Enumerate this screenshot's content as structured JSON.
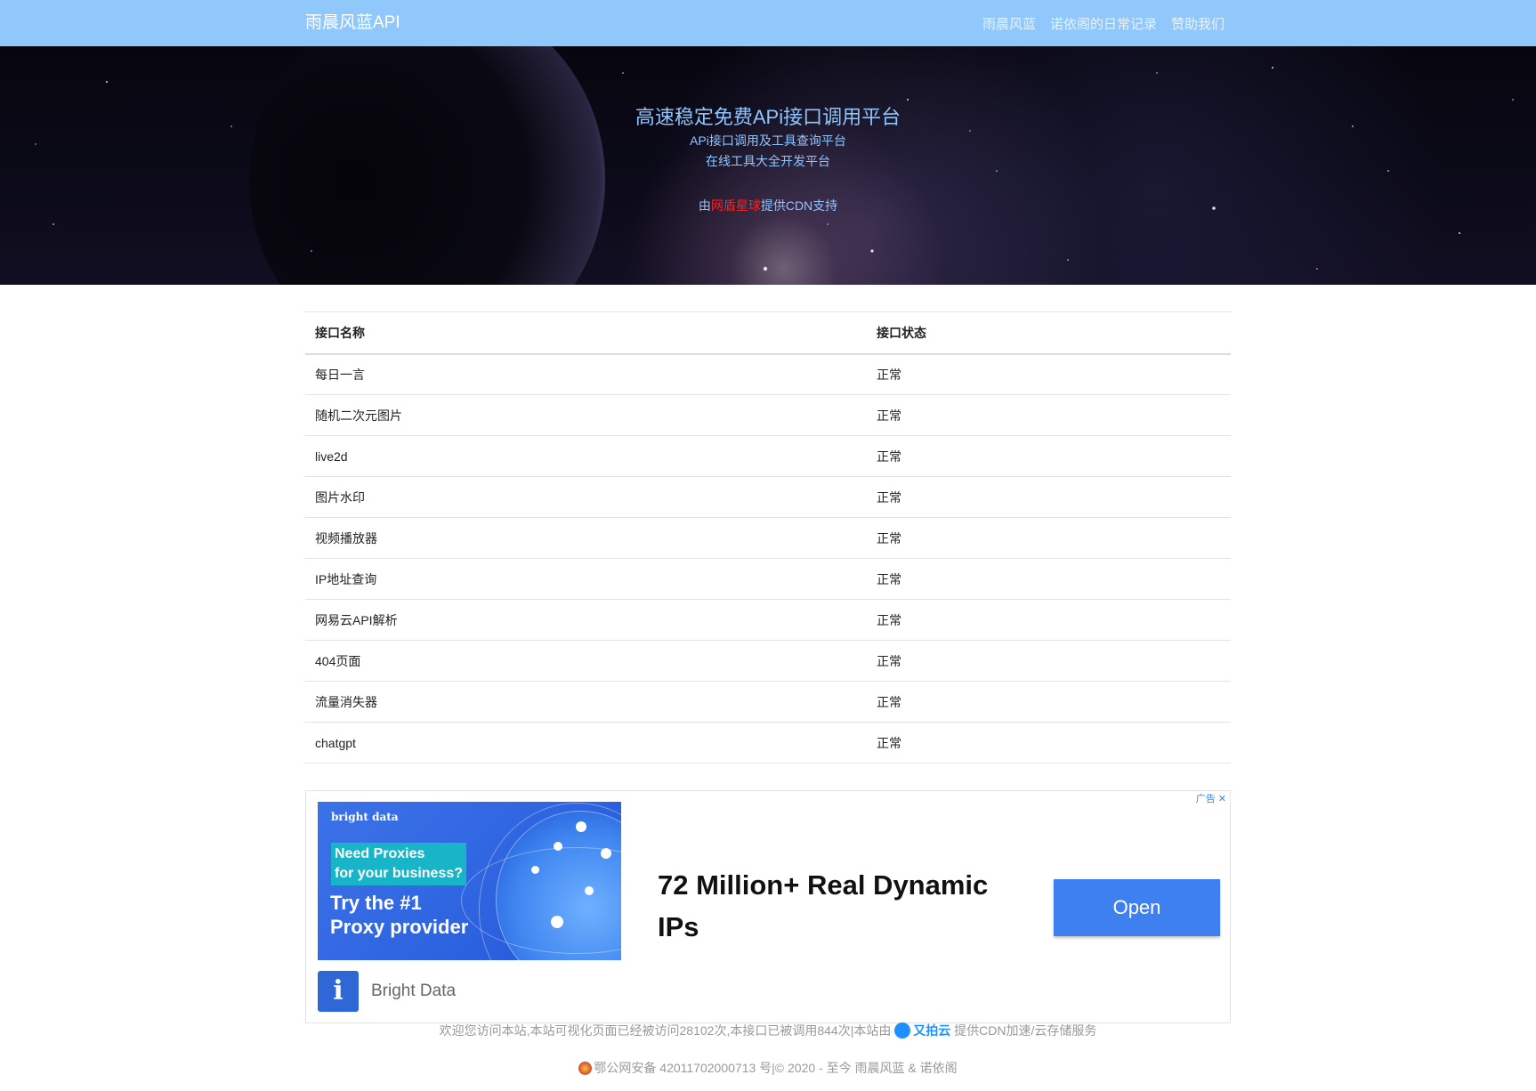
{
  "navbar": {
    "brand": "雨晨风蓝API",
    "links": [
      "雨晨风蓝",
      "诺依阁的日常记录",
      "赞助我们"
    ]
  },
  "hero": {
    "title": "高速稳定免费APi接口调用平台",
    "subtitle1": "APi接口调用及工具查询平台",
    "subtitle2": "在线工具大全开发平台",
    "cdn_prefix": "由",
    "cdn_name": "网盾星球",
    "cdn_suffix": "提供CDN支持"
  },
  "table": {
    "headers": [
      "接口名称",
      "接口状态"
    ],
    "rows": [
      {
        "name": "每日一言",
        "status": "正常"
      },
      {
        "name": "随机二次元图片",
        "status": "正常"
      },
      {
        "name": "live2d",
        "status": "正常"
      },
      {
        "name": "图片水印",
        "status": "正常"
      },
      {
        "name": "视频播放器",
        "status": "正常"
      },
      {
        "name": "IP地址查询",
        "status": "正常"
      },
      {
        "name": "网易云API解析",
        "status": "正常"
      },
      {
        "name": "404页面",
        "status": "正常"
      },
      {
        "name": "流量消失器",
        "status": "正常"
      },
      {
        "name": "chatgpt",
        "status": "正常"
      }
    ]
  },
  "ad": {
    "flag": "广告 ✕",
    "image_brand": "bright data",
    "image_need_line1": "Need Proxies",
    "image_need_line2": "for your business?",
    "image_try_line1": "Try the #1",
    "image_try_line2": "Proxy provider",
    "headline": "72 Million+ Real Dynamic IPs",
    "cta": "Open",
    "info_icon": "info-icon",
    "advertiser": "Bright Data"
  },
  "footer": {
    "line1_text": "欢迎您访问本站,本站可视化页面已经被访问28102次,本接口已被调用844次|本站由",
    "upyun_label": "又拍云",
    "line1_suffix": "提供CDN加速/云存储服务",
    "line2_text": "鄂公网安备 42011702000713 号|© 2020 - 至今 雨晨风蓝 & 诺依阁"
  },
  "colors": {
    "navbar_bg": "#90c8fc",
    "hero_text": "#8fc4ff",
    "cdn_highlight": "#ff2020",
    "ad_button": "#3e80ef"
  }
}
